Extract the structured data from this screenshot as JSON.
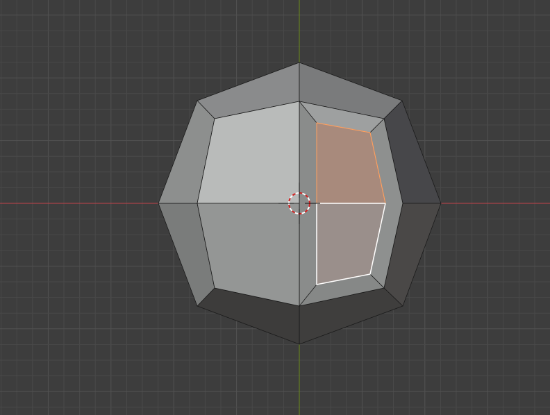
{
  "viewport": {
    "background_color": "#3d3d3d",
    "grid_minor_color": "#494949",
    "grid_major_color": "#525252",
    "x_axis_color": "#c4424a",
    "y_axis_color": "#6a8a1c",
    "edge_color": "#1a1a1a",
    "selected_edge_color": "#ffffff",
    "selected_face_tint": "#ffa060"
  },
  "mesh": {
    "name": "",
    "type": "beveled-octagon",
    "faces": [
      {
        "name": "face-top-left",
        "color": "#8a8b8c"
      },
      {
        "name": "face-top-right",
        "color": "#7a7b7c"
      },
      {
        "name": "face-upper-right",
        "color": "#47474a"
      },
      {
        "name": "face-lower-right",
        "color": "#4a4847"
      },
      {
        "name": "face-bottom-right",
        "color": "#3f3e3d"
      },
      {
        "name": "face-bottom-left",
        "color": "#3d3c3b"
      },
      {
        "name": "face-lower-left",
        "color": "#7a7c7b"
      },
      {
        "name": "face-upper-left",
        "color": "#8d8f8e"
      },
      {
        "name": "inner-bevel-top",
        "color": "#9ea0a0"
      },
      {
        "name": "inner-bevel-right",
        "color": "#8e908f"
      },
      {
        "name": "inner-bevel-bottom",
        "color": "#868887"
      },
      {
        "name": "center-upper-left",
        "color": "#b9bbba"
      },
      {
        "name": "center-lower-left",
        "color": "#949695"
      },
      {
        "name": "selected-upper",
        "color": "#a88a7c",
        "selected": true
      },
      {
        "name": "selected-lower",
        "color": "#9a8f8b",
        "selected": true
      }
    ]
  },
  "cursor_3d": {
    "ring_color_a": "#d22222",
    "ring_color_b": "#ffffff",
    "crosshair_color": "#111111"
  }
}
